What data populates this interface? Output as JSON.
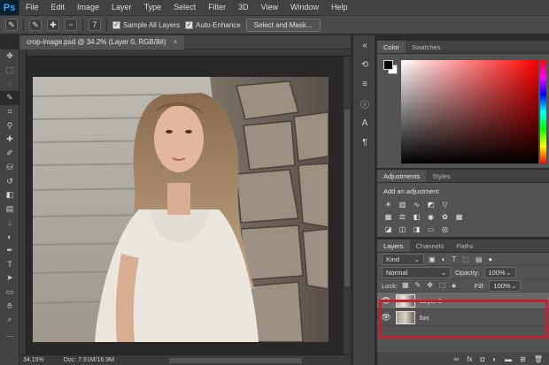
{
  "app": {
    "logo": "Ps"
  },
  "menu": [
    "File",
    "Edit",
    "Image",
    "Layer",
    "Type",
    "Select",
    "Filter",
    "3D",
    "View",
    "Window",
    "Help"
  ],
  "options": {
    "brush_size": "7",
    "sample_all_layers_label": "Sample All Layers",
    "sample_all_layers_checked": true,
    "auto_enhance_label": "Auto-Enhance",
    "auto_enhance_checked": true,
    "select_mask_label": "Select and Mask..."
  },
  "document": {
    "tab_title": "crop-image.psd @ 34.2% (Layer 0, RGB/8#)",
    "close_glyph": "×"
  },
  "status": {
    "zoom": "34.15%",
    "doc_info": "Doc: 7.91M/16.9M"
  },
  "tools": [
    "move-icon",
    "marquee-icon",
    "lasso-icon",
    "quick-select-icon",
    "crop-icon",
    "eyedropper-icon",
    "healing-icon",
    "brush-icon",
    "stamp-icon",
    "history-brush-icon",
    "eraser-icon",
    "gradient-icon",
    "blur-icon",
    "dodge-icon",
    "pen-icon",
    "type-icon",
    "path-select-icon",
    "shape-icon",
    "hand-icon",
    "zoom-icon",
    "more-icon"
  ],
  "color_panel": {
    "tabs": [
      "Color",
      "Swatches"
    ],
    "foreground": "#000000",
    "background": "#ffffff",
    "hue": "#ff0000"
  },
  "adjustments_panel": {
    "tabs": [
      "Adjustments",
      "Styles"
    ],
    "title": "Add an adjustment"
  },
  "layers_panel": {
    "tabs": [
      "Layers",
      "Channels",
      "Paths"
    ],
    "filter_kind": "Kind",
    "blend_mode": "Normal",
    "opacity_label": "Opacity:",
    "opacity_value": "100%",
    "lock_label": "Lock:",
    "fill_label": "Fill:",
    "fill_value": "100%",
    "layers": [
      {
        "name": "Layer 0",
        "visible": true,
        "selected": true
      },
      {
        "name": "fon",
        "visible": true,
        "selected": false
      }
    ],
    "highlight_color": "#c1202e"
  }
}
